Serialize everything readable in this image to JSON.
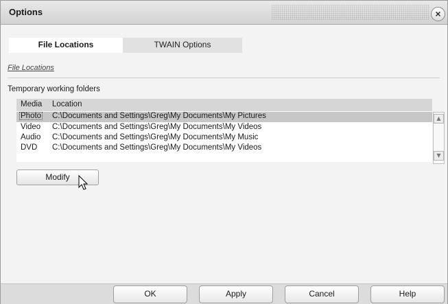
{
  "window": {
    "title": "Options",
    "close_glyph": "×"
  },
  "tabs": [
    {
      "label": "File Locations",
      "active": true
    },
    {
      "label": "TWAIN Options",
      "active": false
    }
  ],
  "breadcrumb": "File Locations",
  "section": {
    "label": "Temporary working folders"
  },
  "table": {
    "columns": [
      "Media",
      "Location"
    ],
    "rows": [
      {
        "media": "Photo",
        "location": "C:\\Documents and Settings\\Greg\\My Documents\\My Pictures",
        "selected": true
      },
      {
        "media": "Video",
        "location": "C:\\Documents and Settings\\Greg\\My Documents\\My Videos",
        "selected": false
      },
      {
        "media": "Audio",
        "location": "C:\\Documents and Settings\\Greg\\My Documents\\My Music",
        "selected": false
      },
      {
        "media": "DVD",
        "location": "C:\\Documents and Settings\\Greg\\My Documents\\My Videos",
        "selected": false
      }
    ]
  },
  "buttons": {
    "modify": "Modify",
    "ok": "OK",
    "apply": "Apply",
    "cancel": "Cancel",
    "help": "Help"
  },
  "icons": {
    "close": "close-icon",
    "scroll_up": "scroll-up-arrow-icon",
    "scroll_down": "scroll-down-arrow-icon",
    "cursor": "mouse-pointer-icon"
  },
  "colors": {
    "titlebar": "#d9d9d9",
    "selected_row": "#c7c7c7",
    "header": "#d6d6d6"
  }
}
